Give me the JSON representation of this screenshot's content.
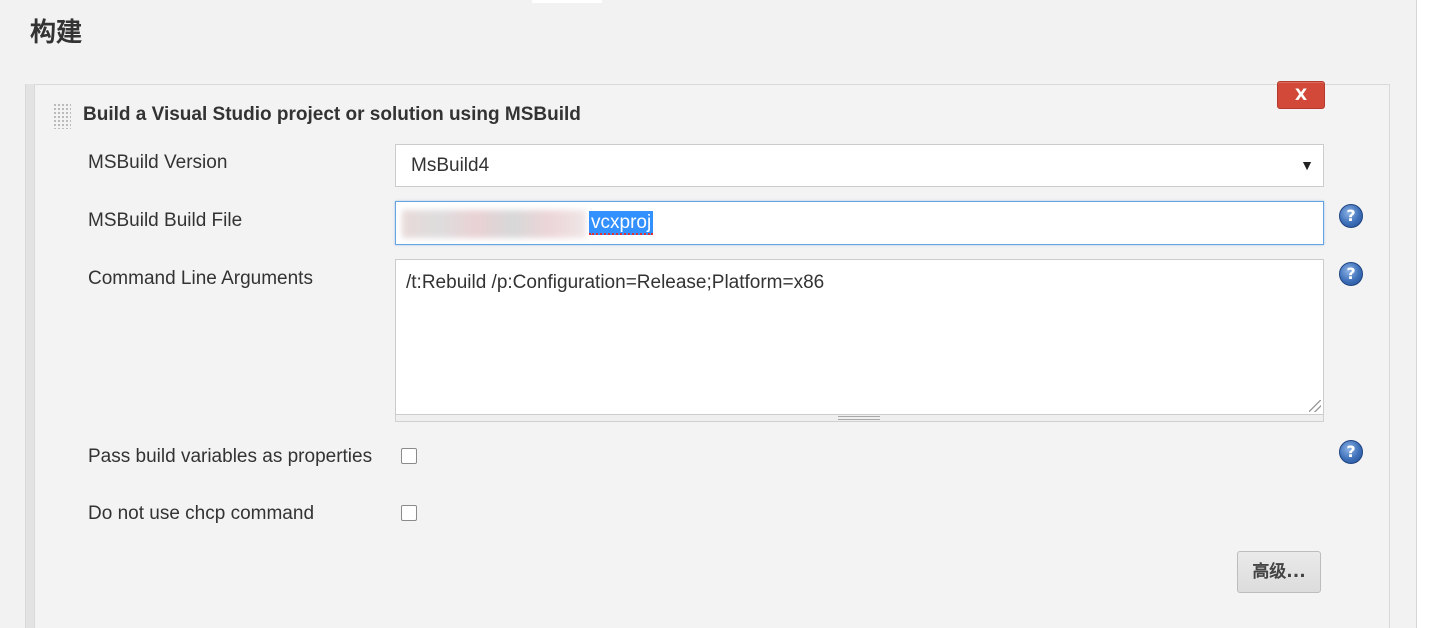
{
  "section": {
    "title": "构建"
  },
  "step": {
    "title": "Build a Visual Studio project or solution using MSBuild",
    "delete_label": "X"
  },
  "fields": {
    "msbuild_version": {
      "label": "MSBuild Version",
      "value": "MsBuild4"
    },
    "build_file": {
      "label": "MSBuild Build File",
      "value_visible": "vcxproj"
    },
    "cmd_args": {
      "label": "Command Line Arguments",
      "value": "/t:Rebuild /p:Configuration=Release;Platform=x86"
    },
    "pass_build_vars": {
      "label": "Pass build variables as properties",
      "checked": false
    },
    "no_chcp": {
      "label": "Do not use chcp command",
      "checked": false
    }
  },
  "advanced_label": "高级...",
  "help_label": "?",
  "icons": {
    "dropdown": "triangle-down-icon",
    "help": "question-circle-icon",
    "drag": "drag-handle-icon"
  }
}
